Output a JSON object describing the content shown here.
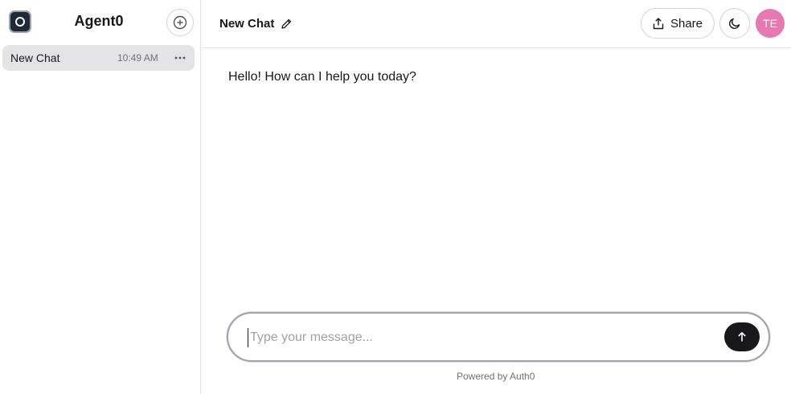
{
  "sidebar": {
    "brand_title": "Agent0",
    "chats": [
      {
        "title": "New Chat",
        "time": "10:49 AM"
      }
    ]
  },
  "header": {
    "title": "New Chat",
    "share_label": "Share",
    "avatar_initials": "TE",
    "avatar_color": "#e879b0"
  },
  "messages": [
    {
      "role": "assistant",
      "text": "Hello! How can I help you today?"
    }
  ],
  "composer": {
    "placeholder": "Type your message...",
    "value": ""
  },
  "footer": {
    "note": "Powered by Auth0"
  },
  "icons": {
    "brand": "agent-logo-icon",
    "new_chat": "plus-circle-icon",
    "more": "more-horizontal-icon",
    "edit": "pencil-icon",
    "share": "share-icon",
    "theme": "moon-icon",
    "send": "arrow-up-icon"
  },
  "colors": {
    "accent_dark": "#18181b",
    "selected_chat_bg": "#e4e4e7",
    "border": "#e4e4e7"
  }
}
